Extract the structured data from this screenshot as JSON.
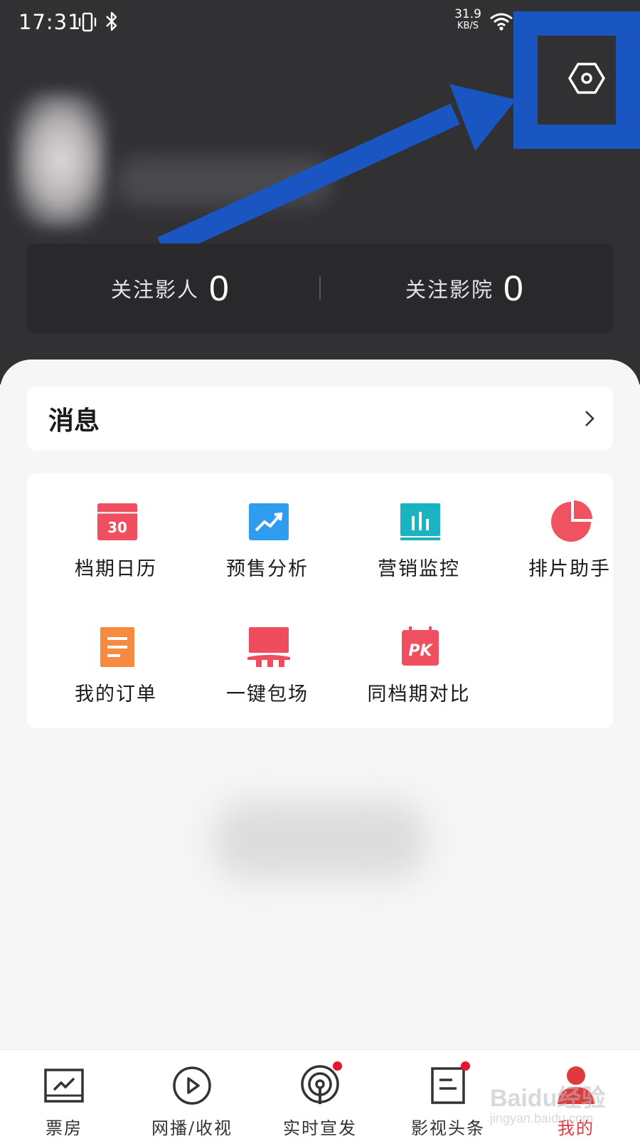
{
  "status_bar": {
    "time": "17:31",
    "net_speed": "31.9",
    "net_unit": "KB/S",
    "icons": [
      "vibrate-icon",
      "bluetooth-icon",
      "wifi-icon"
    ]
  },
  "header": {
    "settings_icon": "settings-hexagon-icon",
    "follow": [
      {
        "label": "关注影人",
        "count": "0"
      },
      {
        "label": "关注影院",
        "count": "0"
      }
    ]
  },
  "messages": {
    "label": "消息",
    "icon": "chevron-right-icon"
  },
  "tools": [
    {
      "label": "档期日历",
      "icon": "calendar-30-icon",
      "color": "#ef4f5f"
    },
    {
      "label": "预售分析",
      "icon": "trend-chart-icon",
      "color": "#2f9cf0"
    },
    {
      "label": "营销监控",
      "icon": "bar-monitor-icon",
      "color": "#1ab4c0"
    },
    {
      "label": "排片助手",
      "icon": "pie-chart-icon",
      "color": "#f1525f"
    },
    {
      "label": "我的订单",
      "icon": "order-list-icon",
      "color": "#f68a3e"
    },
    {
      "label": "一键包场",
      "icon": "screen-hall-icon",
      "color": "#ee4d5b"
    },
    {
      "label": "同档期对比",
      "icon": "pk-calendar-icon",
      "color": "#ef4f5f"
    }
  ],
  "tabs": [
    {
      "label": "票房",
      "icon": "box-office-icon",
      "active": false,
      "badge": false
    },
    {
      "label": "网播/收视",
      "icon": "play-circle-icon",
      "active": false,
      "badge": false
    },
    {
      "label": "实时宣发",
      "icon": "broadcast-icon",
      "active": false,
      "badge": true
    },
    {
      "label": "影视头条",
      "icon": "news-icon",
      "active": false,
      "badge": true
    },
    {
      "label": "我的",
      "icon": "profile-icon",
      "active": true,
      "badge": false
    }
  ],
  "colors": {
    "accent": "#e03a3f",
    "header_bg": "#313134",
    "annotation": "#1a56c1"
  },
  "watermark": {
    "line1": "Baidu经验",
    "line2": "jingyan.baidu.com"
  }
}
